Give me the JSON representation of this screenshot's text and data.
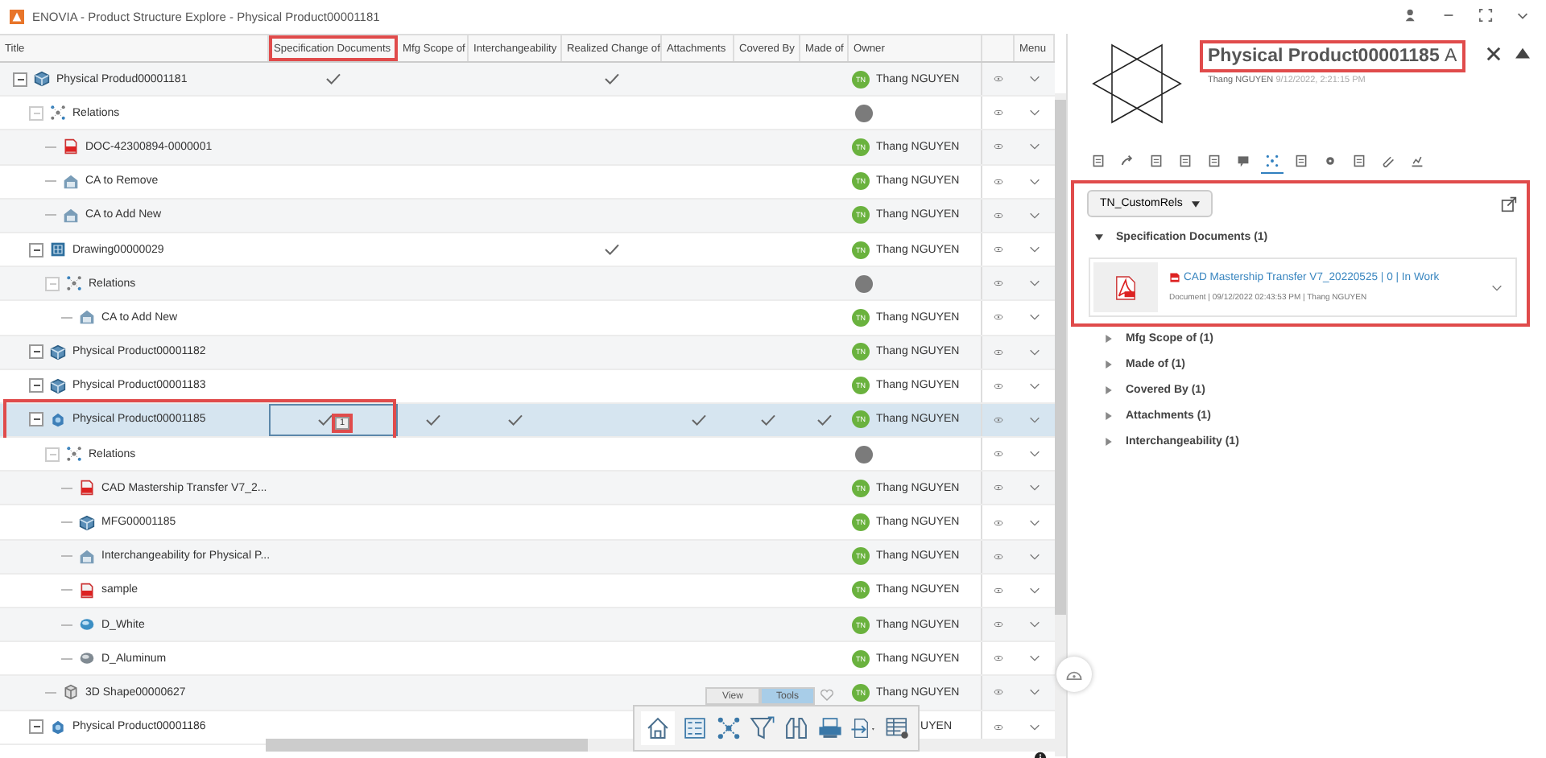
{
  "window": {
    "title": "ENOVIA - Product Structure Explore - Physical Product00001181"
  },
  "table": {
    "columns": [
      {
        "label": "Title",
        "highlighted": false
      },
      {
        "label": "Specification Documents",
        "highlighted": true
      },
      {
        "label": "Mfg Scope of",
        "highlighted": false
      },
      {
        "label": "Interchangeability",
        "highlighted": false
      },
      {
        "label": "Realized Change of",
        "highlighted": false
      },
      {
        "label": "Attachments",
        "highlighted": false
      },
      {
        "label": "Covered By",
        "highlighted": false
      },
      {
        "label": "Made of",
        "highlighted": false
      },
      {
        "label": "Owner",
        "highlighted": false
      },
      {
        "label": "Menu",
        "highlighted": false
      }
    ],
    "rows": [
      {
        "title": "Physical Produd00001181",
        "kind": "product",
        "expanded": true,
        "selected": false,
        "checks": {
          "spec": true,
          "realized": true
        },
        "owner": "Thang NGUYEN",
        "initials": "TN",
        "children": [
          {
            "title": "Relations",
            "kind": "relations",
            "expanded": true,
            "selected": false,
            "children": [
              {
                "title": "DOC-42300894-0000001",
                "kind": "pdf",
                "selected": false,
                "owner": "Thang NGUYEN",
                "initials": "TN"
              },
              {
                "title": "CA to Remove",
                "kind": "change",
                "selected": false,
                "owner": "Thang NGUYEN",
                "initials": "TN"
              },
              {
                "title": "CA to Add New",
                "kind": "change",
                "selected": false,
                "owner": "Thang NGUYEN",
                "initials": "TN"
              }
            ]
          },
          {
            "title": "Drawing00000029",
            "kind": "drawing",
            "expanded": true,
            "selected": false,
            "checks": {
              "realized": true
            },
            "owner": "Thang NGUYEN",
            "initials": "TN",
            "children": [
              {
                "title": "Relations",
                "kind": "relations",
                "expanded": true,
                "selected": false,
                "children": [
                  {
                    "title": "CA to Add New",
                    "kind": "change",
                    "selected": false,
                    "owner": "Thang NGUYEN",
                    "initials": "TN"
                  }
                ]
              }
            ]
          },
          {
            "title": "Physical Product00001182",
            "kind": "product",
            "expanded": true,
            "selected": false,
            "owner": "Thang NGUYEN",
            "initials": "TN"
          },
          {
            "title": "Physical Product00001183",
            "kind": "product",
            "expanded": true,
            "selected": false,
            "owner": "Thang NGUYEN",
            "initials": "TN"
          },
          {
            "title": "Physical Product00001185",
            "kind": "part",
            "expanded": true,
            "selected": true,
            "highlighted": true,
            "badge": "1",
            "checks": {
              "spec": true,
              "mfg": true,
              "interchange": true,
              "attachments": true,
              "covered": true,
              "made": true
            },
            "owner": "Thang NGUYEN",
            "initials": "TN",
            "children": [
              {
                "title": "Relations",
                "kind": "relations",
                "expanded": true,
                "selected": false,
                "children": [
                  {
                    "title": "CAD Mastership Transfer V7_2...",
                    "kind": "pdf",
                    "selected": false,
                    "owner": "Thang NGUYEN",
                    "initials": "TN"
                  },
                  {
                    "title": "MFG00001185",
                    "kind": "product",
                    "selected": false,
                    "owner": "Thang NGUYEN",
                    "initials": "TN"
                  },
                  {
                    "title": "Interchangeability for Physical P...",
                    "kind": "change",
                    "selected": false,
                    "owner": "Thang NGUYEN",
                    "initials": "TN"
                  },
                  {
                    "title": "sample",
                    "kind": "pdf",
                    "selected": false,
                    "owner": "Thang NGUYEN",
                    "initials": "TN"
                  },
                  {
                    "title": "D_White",
                    "kind": "material",
                    "selected": false,
                    "owner": "Thang NGUYEN",
                    "initials": "TN"
                  },
                  {
                    "title": "D_Aluminum",
                    "kind": "metal",
                    "selected": false,
                    "owner": "Thang NGUYEN",
                    "initials": "TN"
                  }
                ]
              },
              {
                "title": "3D Shape00000627",
                "kind": "shape",
                "selected": false,
                "owner": "Thang NGUYEN",
                "initials": "TN"
              }
            ]
          },
          {
            "title": "Physical Product00001186",
            "kind": "part",
            "expanded": true,
            "selected": false,
            "owner": "UYEN"
          }
        ]
      }
    ]
  },
  "toolbar": {
    "tabs": [
      {
        "label": "View",
        "selected": false
      },
      {
        "label": "Tools",
        "selected": true
      }
    ]
  },
  "panel": {
    "title": "Physical Product00001185",
    "revision": "A",
    "title_highlighted": true,
    "author": "Thang NGUYEN",
    "date": "9/12/2022, 2:21:15 PM",
    "tabs": [
      {
        "selected": false
      },
      {
        "selected": false
      },
      {
        "selected": false
      },
      {
        "selected": false
      },
      {
        "selected": false
      },
      {
        "selected": false
      },
      {
        "selected": true
      },
      {
        "selected": false
      },
      {
        "selected": false
      },
      {
        "selected": false
      },
      {
        "selected": false
      },
      {
        "selected": false
      }
    ],
    "filter": "TN_CustomRels",
    "section_highlighted": true,
    "sections": [
      {
        "label": "Specification Documents (1)",
        "expanded": true,
        "items": [
          {
            "name": "CAD Mastership Transfer V7_20220525 | 0 | In Work",
            "meta": "Document | 09/12/2022 02:43:53 PM | Thang NGUYEN"
          }
        ]
      },
      {
        "label": "Mfg Scope of (1)",
        "expanded": false
      },
      {
        "label": "Made of (1)",
        "expanded": false
      },
      {
        "label": "Covered By (1)",
        "expanded": false
      },
      {
        "label": "Attachments (1)",
        "expanded": false
      },
      {
        "label": "Interchangeability (1)",
        "expanded": false
      }
    ]
  }
}
